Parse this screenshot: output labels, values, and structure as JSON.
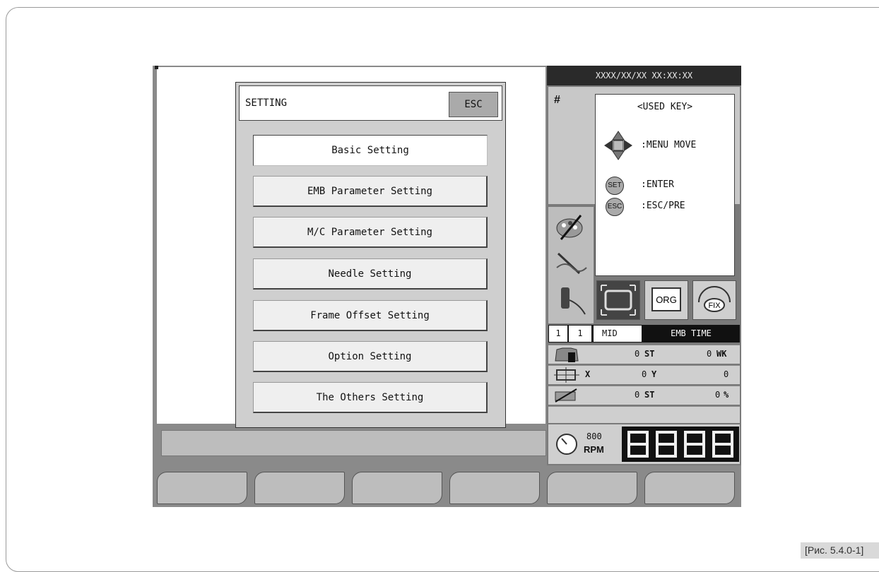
{
  "figure_caption": "[Рис. 5.4.0-1]",
  "screen": {
    "date_time": "XXXX/XX/XX XX:XX:XX",
    "hash_label": "#",
    "dialog": {
      "title": "SETTING",
      "esc_label": "ESC",
      "selected_index": 0,
      "items": [
        "Basic Setting",
        "EMB Parameter Setting",
        "M/C Parameter Setting",
        "Needle Setting",
        "Frame Offset Setting",
        "Option Setting",
        "The Others Setting"
      ]
    },
    "used_key": {
      "title": "<USED KEY>",
      "menu_move": ":MENU MOVE",
      "set_key": "SET",
      "enter": ":ENTER",
      "esc_key": "ESC",
      "esc_pre": ":ESC/PRE"
    },
    "icons": {
      "org_label": "ORG",
      "fix_label": "FIX"
    },
    "status": {
      "num1": "1",
      "num2": "1",
      "mid": "MID",
      "emb_time": "EMB TIME"
    },
    "counters": {
      "st_value": "0",
      "st_unit": "ST",
      "wk_value": "0",
      "wk_unit": "WK",
      "x_label": "X",
      "x_value": "0",
      "y_label": "Y",
      "y_value": "0",
      "st2_value": "0",
      "st2_unit": "ST",
      "pct_value": "0",
      "pct_unit": "%"
    },
    "speed": {
      "rpm_value": "800",
      "rpm_unit": "RPM"
    },
    "soft_key_count": 6,
    "colors": {
      "screen_bg": "#8a8a8a",
      "dark_bar": "#2a2a2a",
      "panel_gray": "#cfcfcf"
    }
  }
}
